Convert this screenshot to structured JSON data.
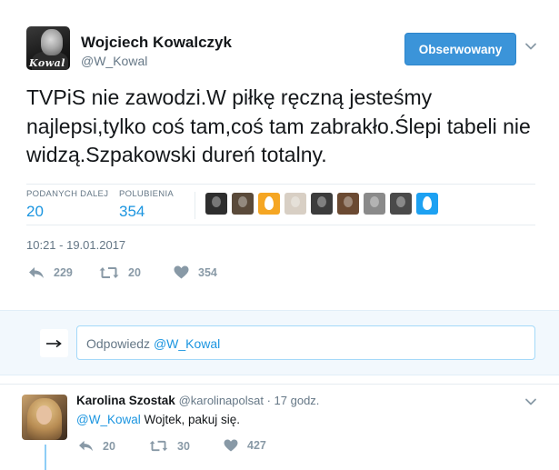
{
  "tweet": {
    "author_name": "Wojciech Kowalczyk",
    "author_handle": "@W_Kowal",
    "avatar_signature": "Kowal",
    "follow_button_label": "Obserwowany",
    "text": "TVPiS nie zawodzi.W piłkę ręczną jesteśmy najlepsi,tylko coś tam,coś tam zabrakło.Ślepi tabeli nie widzą.Szpakowski dureń totalny.",
    "stats": {
      "retweets_label": "PODANYCH DALEJ",
      "retweets_count": "20",
      "likes_label": "POLUBIENIA",
      "likes_count": "354"
    },
    "timestamp": "10:21 - 19.01.2017",
    "actions": {
      "reply_count": "229",
      "retweet_count": "20",
      "like_count": "354"
    }
  },
  "reply_box": {
    "placeholder_prefix": "Odpowiedz ",
    "placeholder_mention": "@W_Kowal"
  },
  "reply_tweet": {
    "author_name": "Karolina Szostak",
    "author_handle": "@karolinapolsat",
    "separator": " · ",
    "time_ago": "17 godz.",
    "mention": "@W_Kowal",
    "text": " Wojtek, pakuj się.",
    "actions": {
      "reply_count": "20",
      "retweet_count": "30",
      "like_count": "427"
    }
  },
  "colors": {
    "accent": "#1b95e0",
    "follow_button": "#3b94d9",
    "muted": "#657786",
    "icon_gray": "#8899a6",
    "reply_bar_bg": "#f2f8fd",
    "egg_orange": "#f5a623",
    "egg_blue": "#1da1f2"
  },
  "icons": {
    "caret": "chevron-down-icon",
    "reply": "reply-icon",
    "retweet": "retweet-icon",
    "like": "heart-icon",
    "reply_arrow": "arrow-right-icon"
  },
  "likers": [
    {
      "name": "liker-1",
      "bg": "#2e2e2e"
    },
    {
      "name": "liker-2",
      "bg": "#5a4a3a"
    },
    {
      "name": "liker-3-egg-orange",
      "bg": "#f5a623"
    },
    {
      "name": "liker-4",
      "bg": "#d8cfc4"
    },
    {
      "name": "liker-5",
      "bg": "#3c3c3c"
    },
    {
      "name": "liker-6",
      "bg": "#6b4a32"
    },
    {
      "name": "liker-7",
      "bg": "#8a8a8a"
    },
    {
      "name": "liker-8",
      "bg": "#4a4a4a"
    },
    {
      "name": "liker-9-egg-blue",
      "bg": "#1da1f2"
    }
  ]
}
